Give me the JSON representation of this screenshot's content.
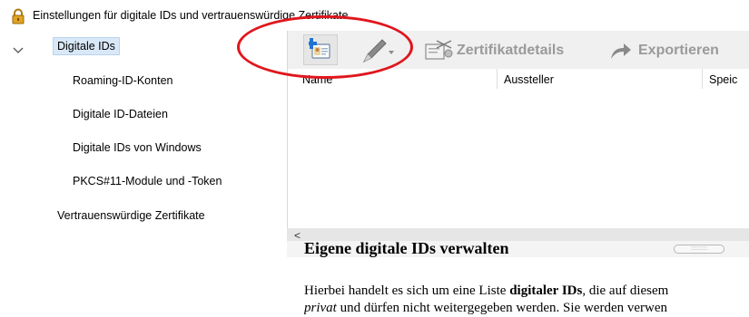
{
  "window": {
    "title": "Einstellungen für digitale IDs und vertrauenswürdige Zertifikate"
  },
  "sidebar": {
    "items": [
      {
        "label": "Digitale IDs",
        "selected": true,
        "icon": "chevron-down-icon"
      },
      {
        "label": "Roaming-ID-Konten"
      },
      {
        "label": "Digitale ID-Dateien"
      },
      {
        "label": "Digitale IDs von Windows"
      },
      {
        "label": "PKCS#11-Module und -Token"
      },
      {
        "label": "Vertrauenswürdige Zertifikate"
      }
    ]
  },
  "toolbar": {
    "add_id_icon": "add-digital-id-icon",
    "pen_icon": "pen-icon",
    "cert_details_label": "Zertifikatdetails",
    "export_label": "Exportieren",
    "highlight_color": "#e0161d"
  },
  "table": {
    "columns": [
      "Name",
      "Aussteller",
      "Speic"
    ]
  },
  "content": {
    "heading": "Eigene digitale IDs verwalten",
    "para_line1_a": "Hierbei handelt es sich um eine Liste ",
    "para_line1_b": "digitaler IDs",
    "para_line1_c": ", die auf diesem",
    "para_line2_a": "privat",
    "para_line2_b": " und dürfen nicht weitergegeben werden. Sie werden verwen"
  },
  "colors": {
    "selection_bg": "#d9e8f7",
    "toolbar_bg": "#f0f0f0",
    "disabled_text": "#9a9a9a"
  }
}
